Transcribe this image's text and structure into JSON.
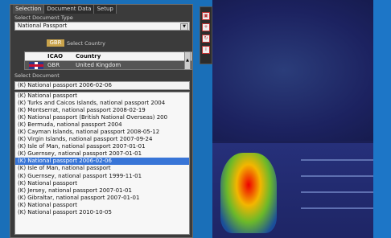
{
  "tabs": [
    "Selection",
    "Document Data",
    "Setup"
  ],
  "select_document_type": {
    "label": "Select Document Type",
    "value": "National Passport"
  },
  "select_country": {
    "chip": "GBR",
    "label": "Select Country",
    "headers": [
      "ICAO",
      "Country"
    ],
    "rows": [
      {
        "icao": "GBR",
        "country": "United Kingdom"
      }
    ]
  },
  "select_document": {
    "label": "Select Document",
    "value": "(K) National passport 2006-02-06"
  },
  "documents": [
    "(K) National passport",
    "(K) Turks and Caicos Islands, national passport 2004",
    "(K) Montserrat, national passport 2008-02-19",
    "(K) National passport (British National Overseas) 200",
    "(K) Bermuda, national passport 2004",
    "(K) Cayman Islands, national passport 2008-05-12",
    "(K) Virgin Islands, national passport 2007-09-24",
    "(K) Isle of Man, national passport 2007-01-01",
    "(K) Guernsey, national passport 2007-01-01",
    "(K) National passport 2006-02-06",
    "(K) Isle of Man, national passport",
    "(K) Guernsey, national passport 1999-11-01",
    "(K) National passport",
    "(K) Jersey, national passport 2007-01-01",
    "(K) Gibraltar, national passport 2007-01-01",
    "(K) National passport",
    "(K) National passport 2010-10-05"
  ],
  "selected_index": 9,
  "icons": [
    "image-view-icon",
    "zoom-icon",
    "rotate-icon",
    "info-icon"
  ]
}
